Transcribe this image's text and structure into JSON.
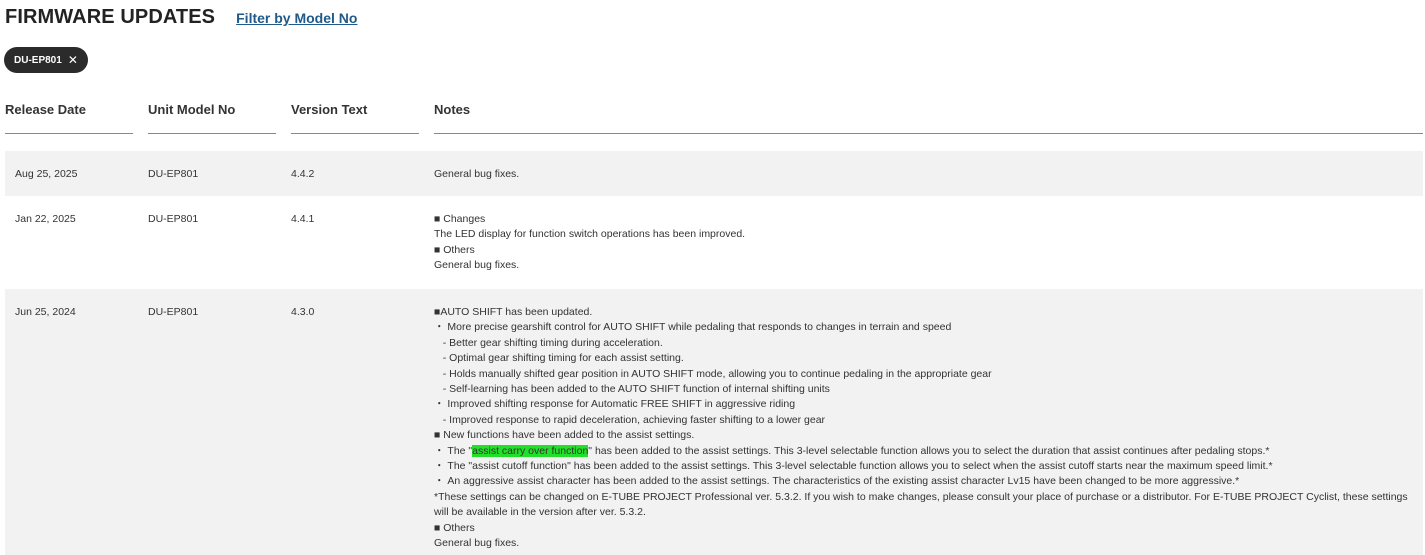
{
  "header": {
    "title": "FIRMWARE UPDATES",
    "filter_link": "Filter by Model No"
  },
  "filter_chip": {
    "label": "DU-EP801",
    "close_glyph": "✕"
  },
  "table": {
    "columns": [
      "Release Date",
      "Unit Model No",
      "Version Text",
      "Notes"
    ],
    "rows": [
      {
        "date": "Aug 25, 2025",
        "model": "DU-EP801",
        "version": "4.4.2",
        "notes": [
          "General bug fixes."
        ]
      },
      {
        "date": "Jan 22, 2025",
        "model": "DU-EP801",
        "version": "4.4.1",
        "notes": [
          "■ Changes",
          "The LED display for function switch operations has been improved.",
          "■ Others",
          "General bug fixes."
        ]
      },
      {
        "date": "Jun 25, 2024",
        "model": "DU-EP801",
        "version": "4.3.0",
        "notes": [
          "■AUTO SHIFT has been updated.",
          "・ More precise gearshift control for AUTO SHIFT while pedaling that responds to changes in terrain and speed",
          "   - Better gear shifting timing during acceleration.",
          "   - Optimal gear shifting timing for each assist setting.",
          "   - Holds manually shifted gear position in AUTO SHIFT mode, allowing you to continue pedaling in the appropriate gear",
          "   - Self-learning has been added to the AUTO SHIFT function of internal shifting units",
          "・ Improved shifting response for Automatic FREE SHIFT in aggressive riding",
          "   - Improved response to rapid deceleration, achieving faster shifting to a lower gear",
          "■ New functions have been added to the assist settings.",
          "・ The \"",
          "・ The \"assist cutoff function\" has been added to the assist settings. This 3-level selectable function allows you to select when the assist cutoff starts near the maximum speed limit.*",
          "・ An aggressive assist character has been added to the assist settings. The characteristics of the existing assist character Lv15 have been changed to be more aggressive.*",
          "*These settings can be changed on E-TUBE PROJECT Professional ver. 5.3.2. If you wish to make changes, please consult your place of purchase or a distributor. For E-TUBE PROJECT Cyclist, these settings will be available in the version after ver. 5.3.2.",
          "■ Others",
          "General bug fixes."
        ],
        "highlight_text": "assist carry over function",
        "highlight_after": "\" has been added to the assist settings. This 3-level selectable function allows you to select the duration that assist continues after pedaling stops.*"
      }
    ]
  },
  "colors": {
    "link": "#1f5a8a",
    "chip_bg": "#2b2b2b",
    "row_shade": "#f2f2f2",
    "highlight": "#22e02a"
  }
}
